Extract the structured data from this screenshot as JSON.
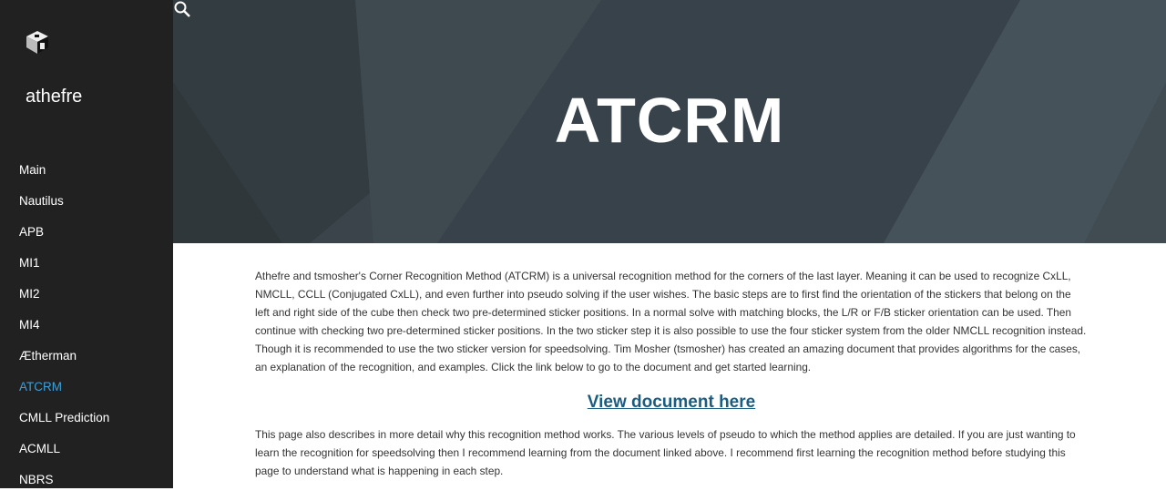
{
  "site_title": "athefre",
  "nav": [
    "Main",
    "Nautilus",
    "APB",
    "MI1",
    "MI2",
    "MI4",
    "Ætherman",
    "ATCRM",
    "CMLL Prediction",
    "ACMLL",
    "NBRS"
  ],
  "active_nav": "ATCRM",
  "page_title": "ATCRM",
  "paragraph1": "Athefre and tsmosher's Corner Recognition Method (ATCRM) is a universal recognition method for the corners of the last layer. Meaning it can be used to recognize CxLL, NMCLL, CCLL (Conjugated CxLL), and even further into pseudo solving if the user wishes. The basic steps are to first find the orientation of the stickers that belong on the left and right side of the cube then check two pre-determined sticker positions. In a normal solve with matching blocks, the L/R or F/B sticker orientation can be used. Then continue with checking two pre-determined sticker positions. In the two sticker step it is also possible to use the four sticker system from the older NMCLL recognition instead. Though it is recommended to use the two sticker version for speedsolving. Tim Mosher (tsmosher) has created an amazing document that provides algorithms for the cases, an explanation of the recognition, and examples. Click the link below to go to the document and get started learning.",
  "link_label": "View document here",
  "paragraph2": "This page also describes in more detail why this recognition method works. The various levels of pseudo to which the method applies are detailed. If you are just wanting to learn the recognition for speedsolving then I recommend learning from the document linked above. I recommend first learning the recognition method before studying this page to understand what is happening in each step.",
  "colors": {
    "sidebar": "#212121",
    "active": "#3d9fd8",
    "link": "#1a5d80",
    "hero": "#3a444a"
  }
}
